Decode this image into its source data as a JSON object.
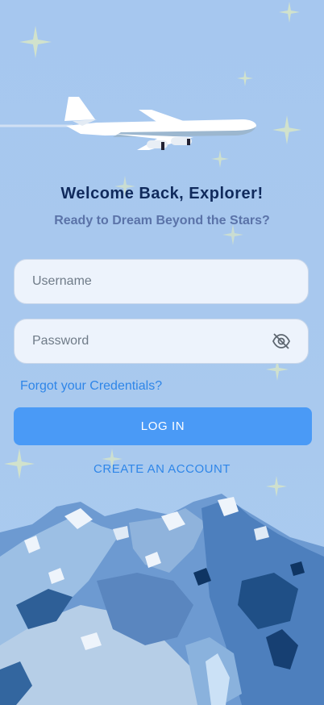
{
  "header": {
    "title": "Welcome Back, Explorer!",
    "subtitle": "Ready to Dream Beyond the Stars?"
  },
  "form": {
    "username_placeholder": "Username",
    "username_value": "",
    "password_placeholder": "Password",
    "password_value": "",
    "forgot_label": "Forgot your Credentials?",
    "login_label": "LOG IN",
    "create_label": "CREATE AN ACCOUNT"
  },
  "icons": {
    "password_toggle": "eye-off-icon",
    "sparkle": "sparkle-star-icon",
    "plane": "airplane-illustration"
  },
  "colors": {
    "background": "#a6c7ef",
    "title": "#102a5c",
    "subtitle": "#5b73a8",
    "accent": "#4a9af6",
    "link": "#2f86e8",
    "field_bg": "#edf3fc"
  }
}
